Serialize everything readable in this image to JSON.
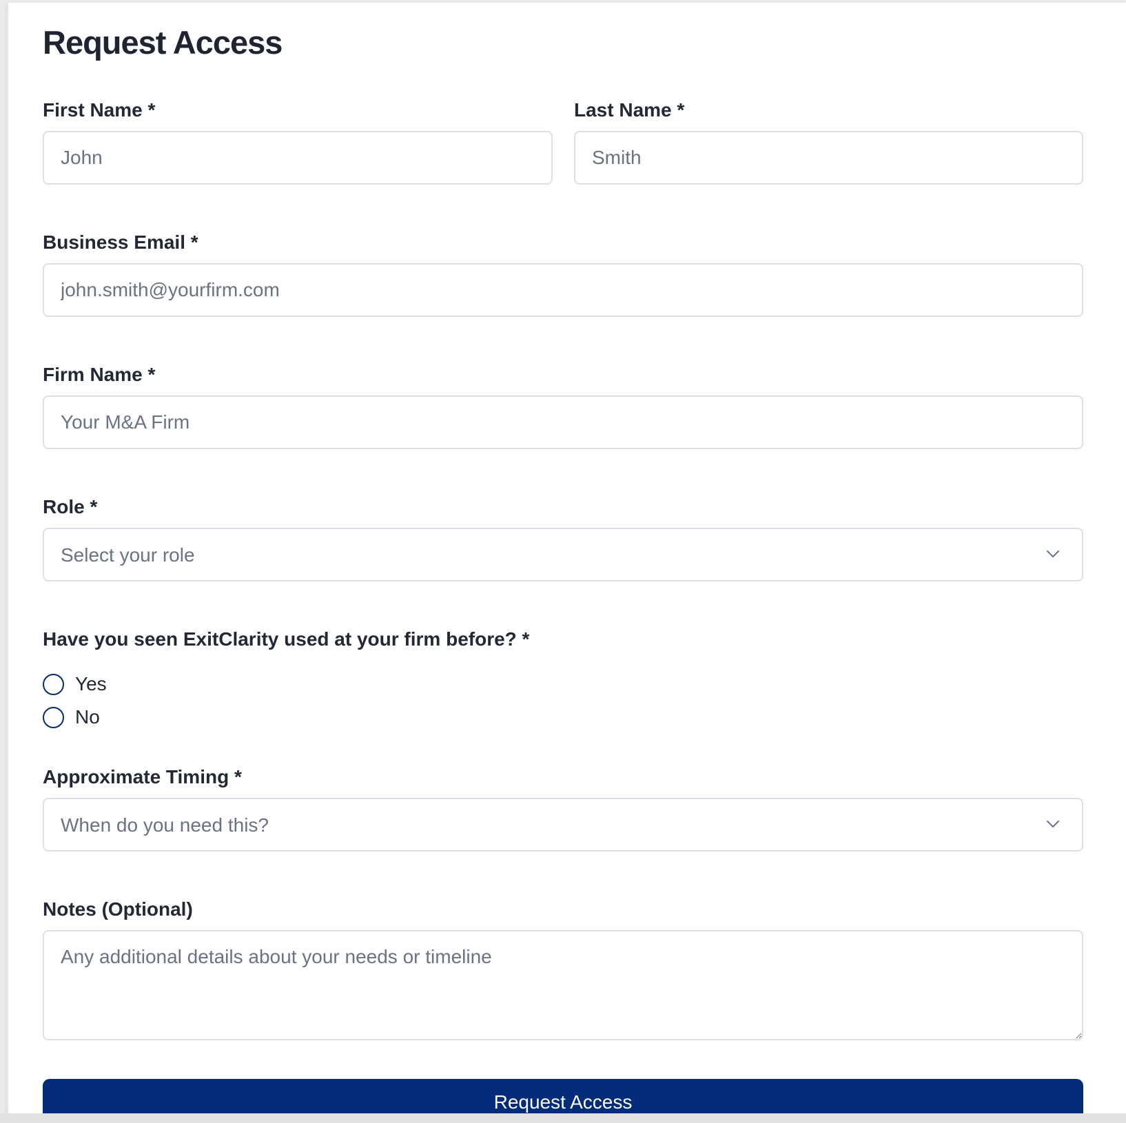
{
  "form": {
    "title": "Request Access",
    "first_name": {
      "label": "First Name *",
      "placeholder": "John"
    },
    "last_name": {
      "label": "Last Name *",
      "placeholder": "Smith"
    },
    "email": {
      "label": "Business Email *",
      "placeholder": "john.smith@yourfirm.com"
    },
    "firm": {
      "label": "Firm Name *",
      "placeholder": "Your M&A Firm"
    },
    "role": {
      "label": "Role *",
      "selected": "Select your role",
      "icon": "chevron-down-icon"
    },
    "seen_before": {
      "label": "Have you seen ExitClarity used at your firm before? *",
      "options": [
        "Yes",
        "No"
      ]
    },
    "timing": {
      "label": "Approximate Timing *",
      "selected": "When do you need this?",
      "icon": "chevron-down-icon"
    },
    "notes": {
      "label": "Notes (Optional)",
      "placeholder": "Any additional details about your needs or timeline"
    },
    "submit_label": "Request Access"
  },
  "colors": {
    "primary": "#022b79",
    "radio_border": "#0a2a6e",
    "input_border": "#dcdfe5",
    "placeholder": "#6b7280",
    "text": "#232833"
  }
}
